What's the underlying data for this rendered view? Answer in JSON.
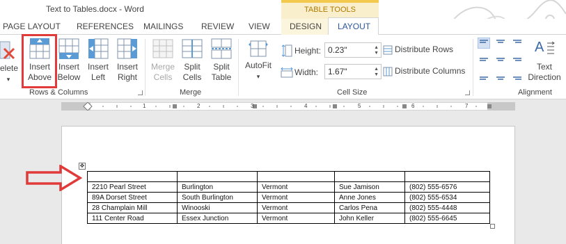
{
  "window": {
    "title": "Text to Tables.docx - Word",
    "contextual_header": "TABLE TOOLS"
  },
  "tabs": {
    "page_layout": "PAGE LAYOUT",
    "references": "REFERENCES",
    "mailings": "MAILINGS",
    "review": "REVIEW",
    "view": "VIEW",
    "design": "DESIGN",
    "layout": "LAYOUT"
  },
  "ribbon": {
    "rows_columns": {
      "delete_label": "elete",
      "insert_above": [
        "Insert",
        "Above"
      ],
      "insert_below": [
        "Insert",
        "Below"
      ],
      "insert_left": [
        "Insert",
        "Left"
      ],
      "insert_right": [
        "Insert",
        "Right"
      ],
      "group_label": "Rows & Columns"
    },
    "merge": {
      "merge_cells": [
        "Merge",
        "Cells"
      ],
      "split_cells": [
        "Split",
        "Cells"
      ],
      "split_table": [
        "Split",
        "Table"
      ],
      "group_label": "Merge"
    },
    "cell_size": {
      "autofit": "AutoFit",
      "height_label": "Height:",
      "height_value": "0.23\"",
      "width_label": "Width:",
      "width_value": "1.67\"",
      "distribute_rows": "Distribute Rows",
      "distribute_columns": "Distribute Columns",
      "group_label": "Cell Size"
    },
    "alignment": {
      "text_direction": [
        "Text",
        "Direction"
      ],
      "group_label": "Alignment"
    }
  },
  "ruler": {
    "numbers": [
      "1",
      "2",
      "3",
      "4",
      "5",
      "6",
      "7"
    ]
  },
  "document": {
    "table_rows": [
      [
        "",
        "",
        "",
        "",
        ""
      ],
      [
        "2210 Pearl Street",
        "Burlington",
        "Vermont",
        "Sue Jamison",
        "(802) 555-6576"
      ],
      [
        "89A Dorset Street",
        "South Burlington",
        "Vermont",
        "Anne Jones",
        "(802) 555-6534"
      ],
      [
        "28 Champlain Mill",
        "Winooski",
        "Vermont",
        "Carlos Pena",
        "(802) 555-4448"
      ],
      [
        "111 Center Road",
        "Essex Junction",
        "Vermont",
        "John Keller",
        "(802) 555-6645"
      ]
    ]
  },
  "colors": {
    "highlight": "#e03a3a",
    "contextual_tab": "#f2c94c",
    "selected_align": "#d5e1f2"
  }
}
